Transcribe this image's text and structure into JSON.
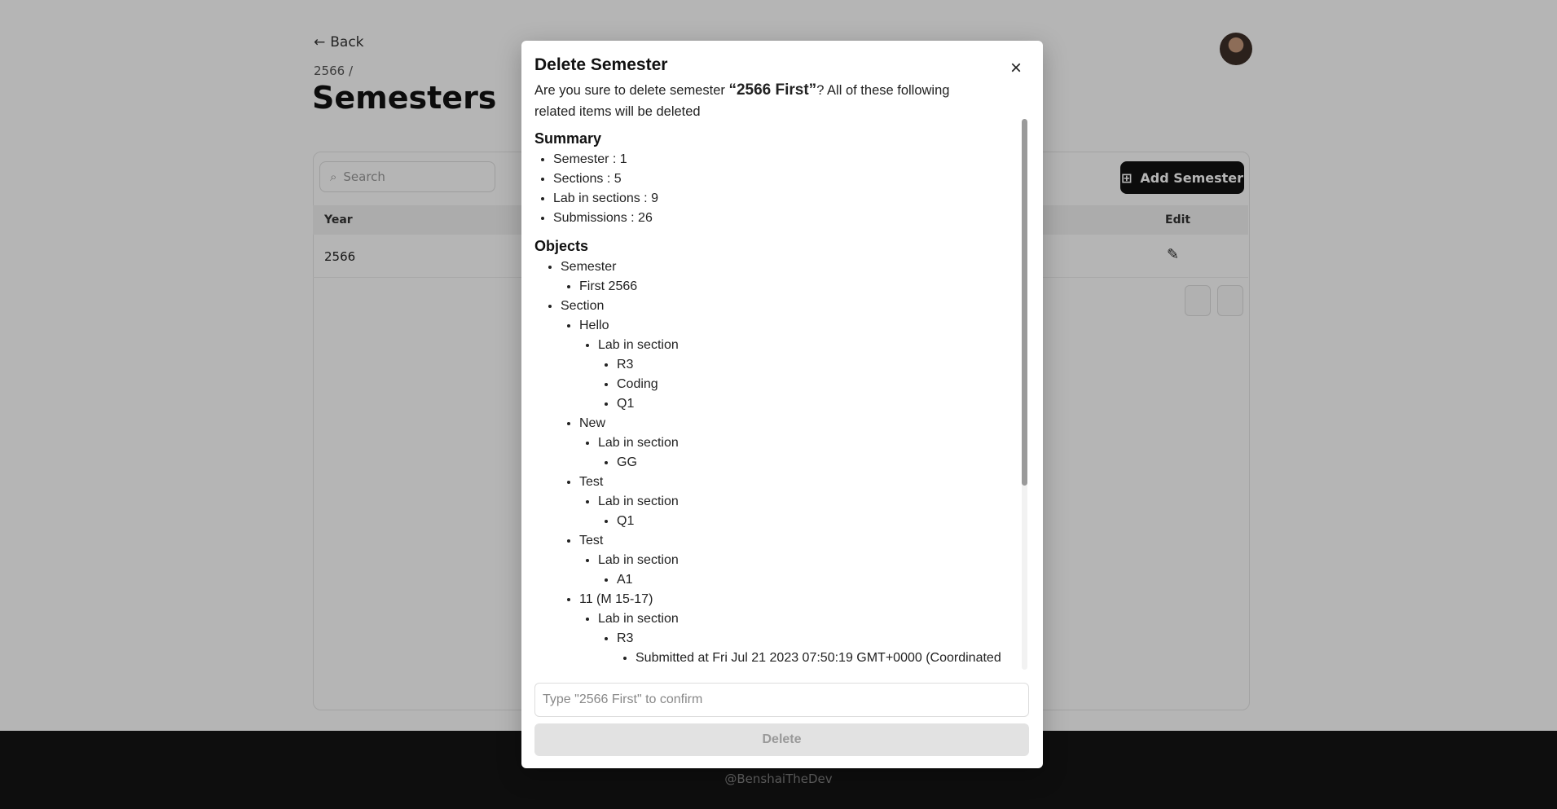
{
  "background": {
    "back_label": "Back",
    "breadcrumb": "2566 /",
    "page_title": "Semesters",
    "search_placeholder": "Search",
    "add_button_label": "Add Semester",
    "table": {
      "headers": [
        "Year",
        "Edit"
      ],
      "rows": [
        [
          "2566",
          ""
        ]
      ]
    },
    "footer_text": "@BenshaiTheDev"
  },
  "modal": {
    "title": "Delete Semester",
    "intro_before": "Are you sure to delete semester ",
    "semester_name": "“2566 First”",
    "intro_after": "? All of these following related items will be deleted",
    "summary_heading": "Summary",
    "summary_items": [
      "Semester : 1",
      "Sections : 5",
      "Lab in sections : 9",
      "Submissions : 26"
    ],
    "objects_heading": "Objects",
    "objects": {
      "semester_label": "Semester",
      "semester_name": "First 2566",
      "section_label": "Section",
      "lab_label": "Lab in section",
      "sections": [
        {
          "name": "Hello",
          "labs": [
            "R3",
            "Coding",
            "Q1"
          ]
        },
        {
          "name": "New",
          "labs": [
            "GG"
          ]
        },
        {
          "name": "Test",
          "labs": [
            "Q1"
          ]
        },
        {
          "name": "Test",
          "labs": [
            "A1"
          ]
        },
        {
          "name": "11 (M 15-17)",
          "labs": [
            "R3"
          ],
          "submission": "Submitted at Fri Jul 21 2023 07:50:19 GMT+0000 (Coordinated"
        }
      ]
    },
    "confirm_placeholder": "Type \"2566 First\" to confirm",
    "delete_label": "Delete"
  },
  "colors": {
    "overlay": "#000000",
    "delete_button_bg": "#e2e2e2",
    "primary_button": "#111111"
  }
}
